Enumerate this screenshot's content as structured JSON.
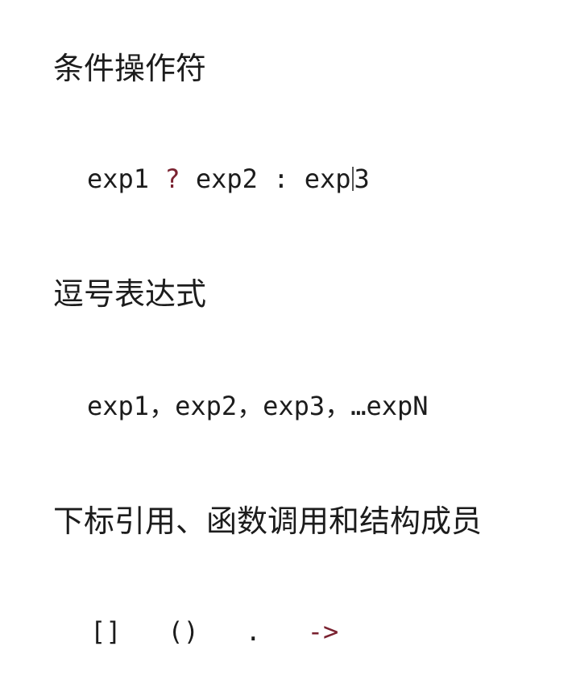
{
  "sections": [
    {
      "heading": "条件操作符",
      "code": {
        "exp1": "exp1",
        "question": "?",
        "exp2": "exp2",
        "colon": ":",
        "exp3_a": "exp",
        "exp3_b": "3"
      }
    },
    {
      "heading": "逗号表达式",
      "code": {
        "text": "exp1，exp2，exp3，…expN"
      }
    },
    {
      "heading": "下标引用、函数调用和结构成员",
      "code": {
        "brackets": "[]",
        "parens": "()",
        "dot": ".",
        "arrow": "->"
      }
    }
  ],
  "colors": {
    "text": "#1c1c1c",
    "accent": "#7a2230"
  }
}
